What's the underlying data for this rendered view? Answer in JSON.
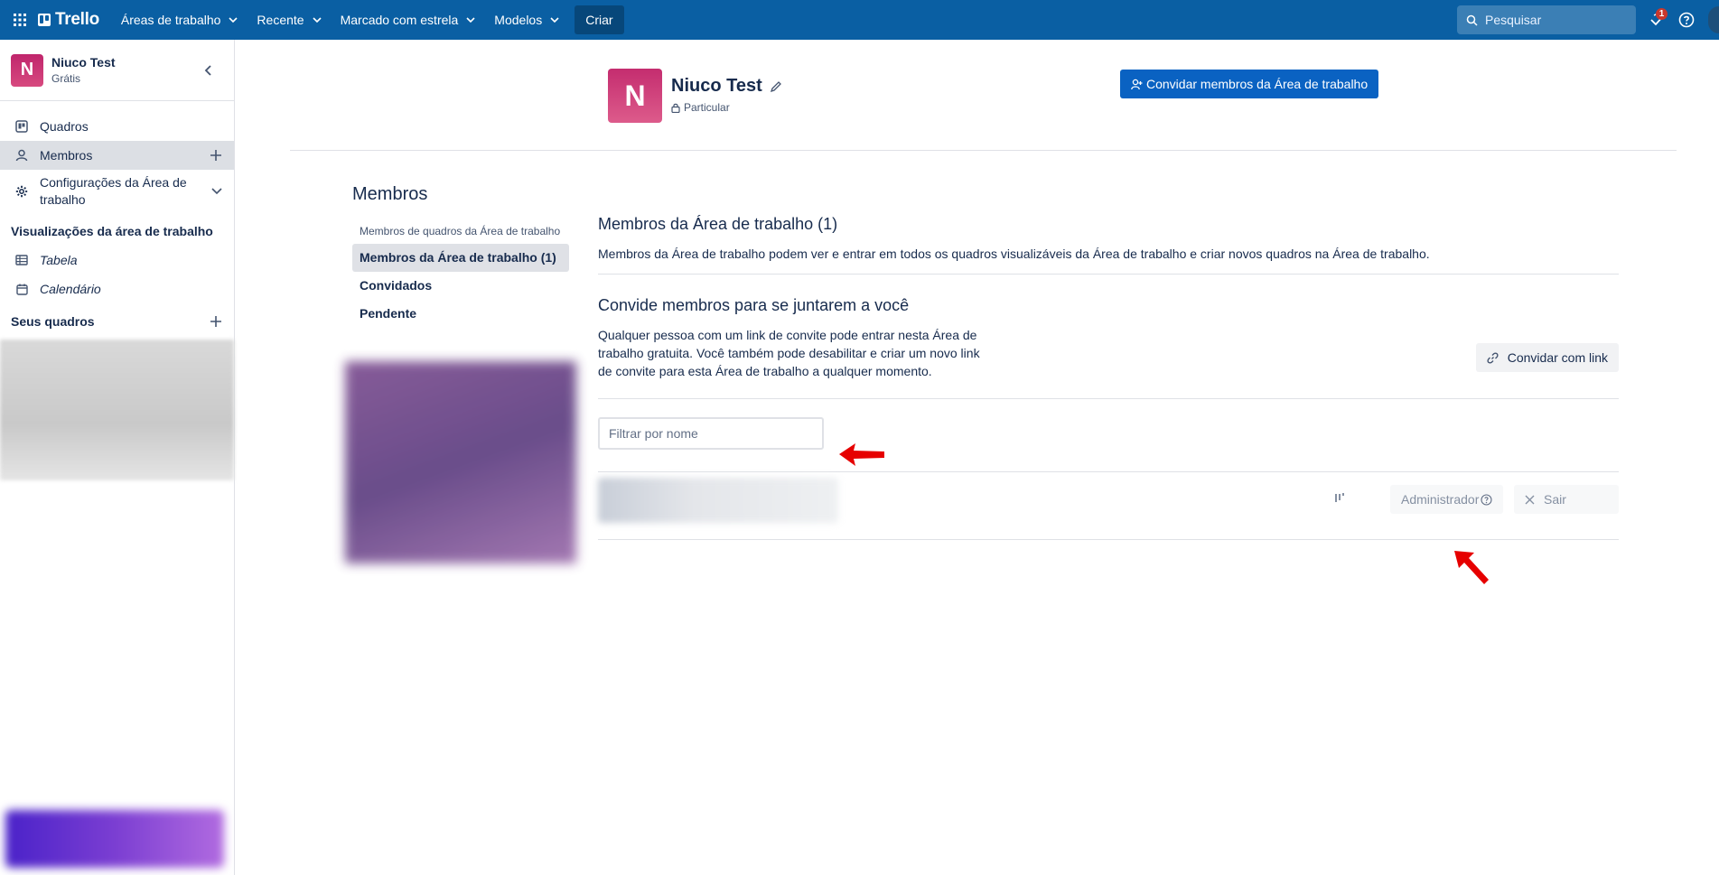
{
  "topnav": {
    "logo": "Trello",
    "menus": [
      {
        "label": "Áreas de trabalho"
      },
      {
        "label": "Recente"
      },
      {
        "label": "Marcado com estrela"
      },
      {
        "label": "Modelos"
      }
    ],
    "create_label": "Criar",
    "search_placeholder": "Pesquisar",
    "notification_count": "1"
  },
  "sidebar": {
    "workspace_initial": "N",
    "workspace_name": "Niuco Test",
    "workspace_plan": "Grátis",
    "items": [
      {
        "label": "Quadros"
      },
      {
        "label": "Membros"
      },
      {
        "label": "Configurações da Área de trabalho"
      }
    ],
    "views_heading": "Visualizações da área de trabalho",
    "views": [
      {
        "label": "Tabela"
      },
      {
        "label": "Calendário"
      }
    ],
    "boards_heading": "Seus quadros"
  },
  "header": {
    "initial": "N",
    "title": "Niuco Test",
    "visibility": "Particular",
    "invite_button": "Convidar membros da Área de trabalho"
  },
  "members_nav": {
    "title": "Membros",
    "items": [
      {
        "label": "Membros de quadros da Área de trabalho"
      },
      {
        "label": "Membros da Área de trabalho (1)"
      },
      {
        "label": "Convidados"
      },
      {
        "label": "Pendente"
      }
    ]
  },
  "content": {
    "members_heading": "Membros da Área de trabalho (1)",
    "members_desc": "Membros da Área de trabalho podem ver e entrar em todos os quadros visualizáveis da Área de trabalho e criar novos quadros na Área de trabalho.",
    "invite_heading": "Convide membros para se juntarem a você",
    "invite_desc": "Qualquer pessoa com um link de convite pode entrar nesta Área de trabalho gratuita. Você também pode desabilitar e criar um novo link de convite para esta Área de trabalho a qualquer momento.",
    "invite_link_button": "Convidar com link",
    "filter_placeholder": "Filtrar por nome",
    "member_row": {
      "role_label": "Administrador",
      "leave_label": "Sair"
    }
  },
  "colors": {
    "nav_bg": "#0a5fa3",
    "primary_button": "#0a62c2",
    "workspace_avatar": "#c42d6f",
    "annotation_arrow": "#e60000"
  },
  "icons": [
    "apps-grid-icon",
    "chevron-down-icon",
    "search-icon",
    "notifications-icon",
    "help-icon",
    "chevron-left-icon",
    "board-icon",
    "person-icon",
    "plus-icon",
    "gear-icon",
    "table-icon",
    "calendar-icon",
    "pencil-icon",
    "lock-icon",
    "add-person-icon",
    "link-icon",
    "bars-icon",
    "question-circle-icon",
    "close-icon"
  ]
}
